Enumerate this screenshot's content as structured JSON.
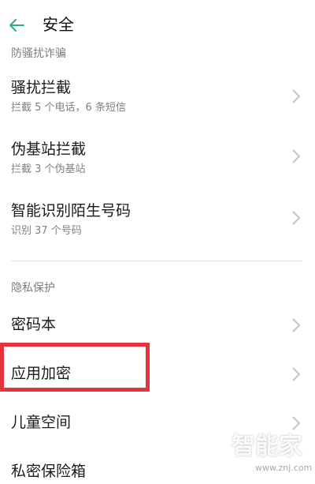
{
  "header": {
    "title": "安全"
  },
  "sections": {
    "anti_harassment": "防骚扰诈骗",
    "privacy": "隐私保护"
  },
  "rows": {
    "harassment_block": {
      "title": "骚扰拦截",
      "subtitle": "拦截 5 个电话，6 条短信"
    },
    "fake_base_station": {
      "title": "伪基站拦截",
      "subtitle": "拦截 3 个伪基站"
    },
    "smart_caller_id": {
      "title": "智能识别陌生号码",
      "subtitle": "识别 37 个号码"
    },
    "password_book": {
      "title": "密码本"
    },
    "app_lock": {
      "title": "应用加密"
    },
    "kids_space": {
      "title": "儿童空间"
    },
    "private_safe": {
      "title": "私密保险箱"
    }
  },
  "watermark": {
    "text": "智能家",
    "url": "www.znj.com"
  },
  "colors": {
    "accent": "#2fae7e",
    "highlight": "#e8323c"
  },
  "icons": {
    "back": "back-arrow-icon",
    "chevron": "chevron-right-icon"
  }
}
